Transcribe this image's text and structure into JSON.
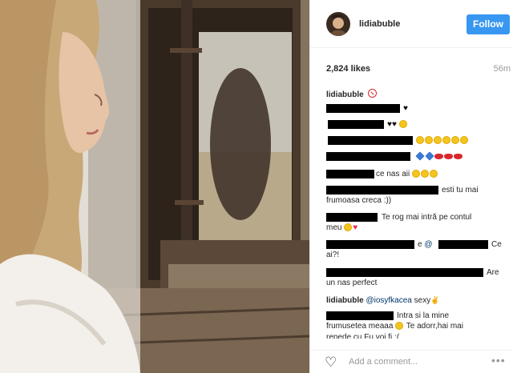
{
  "post": {
    "username": "lidiabuble",
    "follow_label": "Follow",
    "likes": "2,824 likes",
    "time_ago": "56m",
    "caption_user": "lidiabuble",
    "caption_icon": "speaker-off-icon"
  },
  "comments": [
    {
      "text": "♥"
    },
    {
      "text": "♥♥"
    },
    {
      "text": ""
    },
    {
      "text": ""
    },
    {
      "text": "ce nas aii"
    },
    {
      "text_line1": "esti tu mai",
      "text_line2": "frumoasa creca :))"
    },
    {
      "text_line1": "Te rog mai intră pe contul",
      "text_line2": "meu"
    },
    {
      "prefix": "e",
      "mention": "@",
      "suffix": "Ce",
      "text_line2": "ai?!"
    },
    {
      "suffix": "Are",
      "text_line2": "un nas perfect"
    },
    {
      "user": "lidiabuble",
      "mention": "@iosyfkacea",
      "text": "sexy"
    },
    {
      "text_line1": "Intra si la mine",
      "text_line2": "frumusetea meaaa",
      "text_line3": "Te adorr,hai mai",
      "text_line4": "repede cu Fu voi fi :("
    }
  ],
  "footer": {
    "heart_icon": "heart-outline-icon",
    "add_comment_placeholder": "Add a comment...",
    "more_icon": "more-options-icon",
    "more_glyph": "•••"
  },
  "colors": {
    "follow_blue": "#3897f0",
    "mention": "#003569"
  }
}
